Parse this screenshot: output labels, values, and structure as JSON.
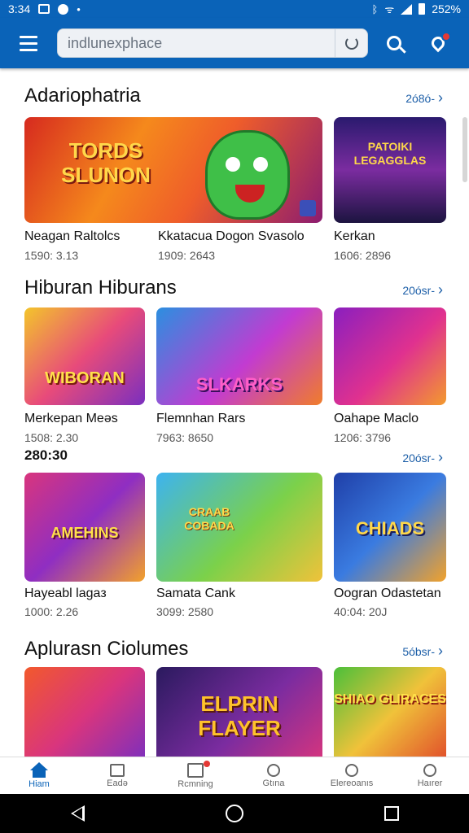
{
  "status_bar": {
    "time": "3:34",
    "battery": "252%"
  },
  "search": {
    "placeholder": "indlunexphace"
  },
  "colors": {
    "primary": "#0a63b8",
    "badge": "#e53935",
    "link": "#1d5fa8"
  },
  "sections": [
    {
      "title": "Adariophatria",
      "see_all": "2ó8ó-",
      "cards": [
        {
          "name": "Neagan Raltolcs",
          "meta": "1590: 3.13",
          "art": "TORDS SLUNON",
          "bg": "linear-gradient(135deg,#d62a1f 0%,#f28a1c 45%,#a11c6e 100%)"
        },
        {
          "name": "Kkatacua Dogon Svasolo",
          "meta": "1909: 2643",
          "art": "",
          "bg": "linear-gradient(135deg,#f2992a 0%,#c8223a 60%,#5a1b6e 100%)"
        },
        {
          "name": "Kerkan",
          "meta": "1606: 2896",
          "art": "PATOIKI LEGAGGLAS",
          "bg": "linear-gradient(180deg,#2a1a6e 0%,#7b2ca0 50%,#1c1440 100%)"
        }
      ]
    },
    {
      "title": "Hiburan Hiburans",
      "see_all": "20ósr-",
      "cards": [
        {
          "name": "Merkepan Meəs",
          "meta": "1508: 2.30",
          "art": "WIBORAN",
          "bg": "linear-gradient(135deg,#f3c52b 0%,#e84b7a 50%,#7a2fbf 100%)"
        },
        {
          "name": "Flemnhan Rars",
          "meta": "7963: 8650",
          "art": "SLKARKS",
          "bg": "linear-gradient(135deg,#2b8fe0 0%,#c23bd1 55%,#f07d2a 100%)"
        },
        {
          "name": "Oahape Maclo",
          "meta": "1206: 3796",
          "art": "",
          "bg": "linear-gradient(135deg,#8a1fbf 0%,#e0318f 55%,#f39a2d 100%)"
        }
      ]
    },
    {
      "inline_label": "280:30",
      "see_all": "20ósr-",
      "cards": [
        {
          "name": "Hayeabl lagaз",
          "meta": "1000: 2.26",
          "art": "AMEHINS",
          "bg": "linear-gradient(135deg,#d9357d 0%,#8f2ec2 50%,#f2a12b 100%)"
        },
        {
          "name": "Samata Cank",
          "meta": "3099: 2580",
          "art": "CRAAB COBADA",
          "bg": "linear-gradient(135deg,#3db3f0 0%,#7bd14a 55%,#f0c23a 100%)"
        },
        {
          "name": "Oogran Odastetan",
          "meta": "40:04: 20J",
          "art": "CHIADS",
          "bg": "linear-gradient(135deg,#1f3fa8 0%,#3a7be0 50%,#f2a22b 100%)"
        }
      ]
    },
    {
      "title": "Aplurasn Ciolumes",
      "see_all": "5óbsr-",
      "cards": [
        {
          "name": "",
          "meta": "",
          "art": "",
          "bg": "linear-gradient(135deg,#f2592c 0%,#d9357d 50%,#7a2fbf 100%)"
        },
        {
          "name": "",
          "meta": "",
          "art": "ELPRIN FLAYER",
          "bg": "linear-gradient(135deg,#2a1a5e 0%,#7b2ca0 55%,#d9357d 100%)"
        },
        {
          "name": "",
          "meta": "",
          "art": "SHIAO GLIRACES",
          "bg": "linear-gradient(135deg,#4bbf3a 0%,#f0c23a 50%,#e04a2a 100%)"
        }
      ]
    }
  ],
  "bottom_nav": [
    {
      "label": "Hiam",
      "icon": "home-icon",
      "active": true
    },
    {
      "label": "Eadə",
      "icon": "chat-icon",
      "active": false
    },
    {
      "label": "Rcmning",
      "icon": "document-icon",
      "active": false
    },
    {
      "label": "Gtına",
      "icon": "profile-search-icon",
      "active": false
    },
    {
      "label": "Elereoanıs",
      "icon": "explore-icon",
      "active": false
    },
    {
      "label": "Haırer",
      "icon": "person-icon",
      "active": false
    }
  ]
}
